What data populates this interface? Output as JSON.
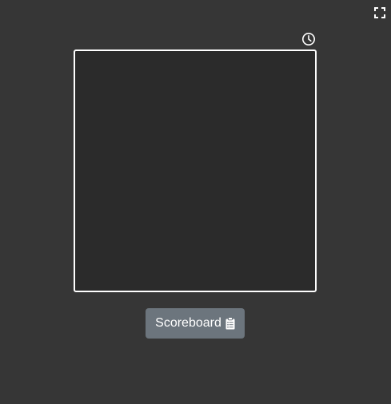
{
  "toolbar": {
    "fullscreen_icon": "fullscreen-icon",
    "timer_icon": "clock-icon"
  },
  "board": {
    "border_color": "#ffffff",
    "background_color": "#2b2b2b"
  },
  "scoreboard": {
    "label": "Scoreboard",
    "icon": "clipboard-list-icon",
    "button_color": "#6c757d"
  },
  "page": {
    "background_color": "#363636"
  }
}
